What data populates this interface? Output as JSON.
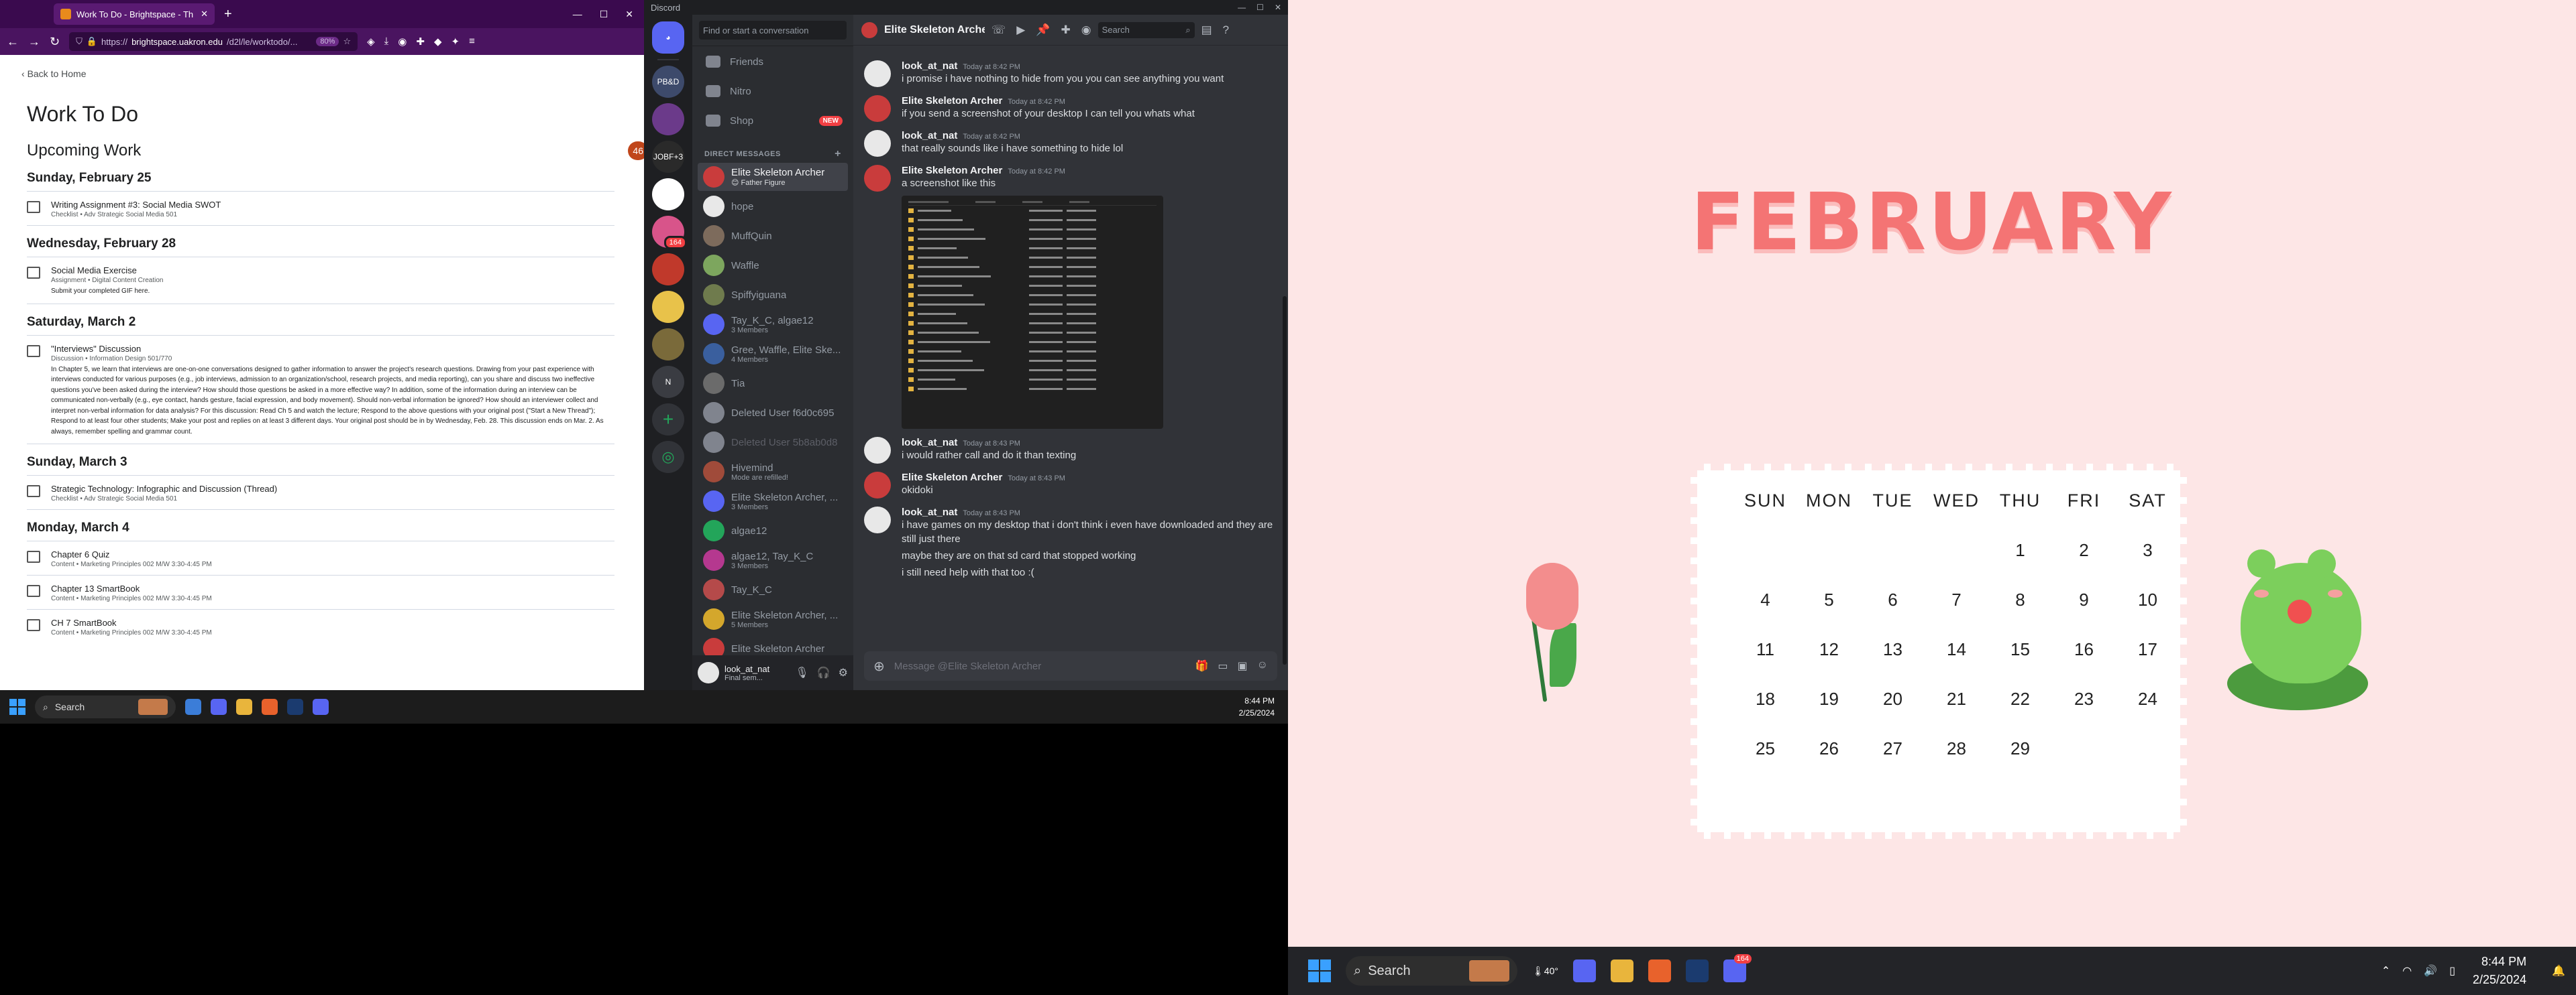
{
  "browser": {
    "tab_title": "Work To Do - Brightspace - Th",
    "url_prefix": "https://",
    "url_domain": "brightspace.uakron.edu",
    "url_path": "/d2l/le/worktodo/...",
    "zoom": "80%"
  },
  "brightspace": {
    "back_label": "Back to Home",
    "title": "Work To Do",
    "upcoming_label": "Upcoming Work",
    "upcoming_count": "46",
    "days": [
      {
        "label": "Sunday, February 25",
        "items": [
          {
            "name": "Writing Assignment #3: Social Media SWOT",
            "meta": "Checklist • Adv Strategic Social Media 501",
            "desc": ""
          }
        ]
      },
      {
        "label": "Wednesday, February 28",
        "items": [
          {
            "name": "Social Media Exercise",
            "meta": "Assignment • Digital Content Creation",
            "desc": "Submit your completed GIF here."
          }
        ]
      },
      {
        "label": "Saturday, March 2",
        "items": [
          {
            "name": "\"Interviews\" Discussion",
            "meta": "Discussion • Information Design 501/770",
            "desc": "In Chapter 5, we learn that interviews are one-on-one conversations designed to gather information to answer the project's research questions. Drawing from your past experience with interviews conducted for various purposes (e.g., job interviews, admission to an organization/school, research projects, and media reporting), can you share and discuss two ineffective questions you've been asked during the interview? How should those questions be asked in a more effective way? In addition, some of the information during an interview can be communicated non-verbally (e.g., eye contact, hands gesture, facial expression, and body movement). Should non-verbal information be ignored? How should an interviewer collect and interpret non-verbal information for data analysis? For this discussion: Read Ch 5 and watch the lecture; Respond to the above questions with your original post (\"Start a New Thread\"); Respond to at least four other students; Make your post and replies on at least 3 different days. Your original post should be in by Wednesday, Feb. 28. This discussion ends on Mar. 2. As always, remember spelling and grammar count."
          }
        ]
      },
      {
        "label": "Sunday, March 3",
        "items": [
          {
            "name": "Strategic Technology: Infographic and Discussion (Thread)",
            "meta": "Checklist • Adv Strategic Social Media 501",
            "desc": ""
          }
        ]
      },
      {
        "label": "Monday, March 4",
        "items": [
          {
            "name": "Chapter 6 Quiz",
            "meta": "Content • Marketing Principles 002 M/W 3:30-4:45 PM",
            "desc": ""
          },
          {
            "name": "Chapter 13 SmartBook",
            "meta": "Content • Marketing Principles 002 M/W 3:30-4:45 PM",
            "desc": ""
          },
          {
            "name": "CH 7 SmartBook",
            "meta": "Content • Marketing Principles 002 M/W 3:30-4:45 PM",
            "desc": ""
          }
        ]
      }
    ]
  },
  "taskbar_left": {
    "search_label": "Search",
    "time": "8:44 PM",
    "date": "2/25/2024"
  },
  "discord": {
    "app_title": "Discord",
    "find_placeholder": "Find or start a conversation",
    "guilds": [
      {
        "label": "PB&D",
        "badge": ""
      },
      {
        "label": "",
        "badge": ""
      },
      {
        "label": "JOBF+3",
        "badge": ""
      },
      {
        "label": "",
        "badge": ""
      },
      {
        "label": "",
        "badge": "164"
      },
      {
        "label": "",
        "badge": ""
      },
      {
        "label": "",
        "badge": ""
      },
      {
        "label": "",
        "badge": ""
      },
      {
        "label": "N",
        "badge": ""
      }
    ],
    "nav": [
      {
        "label": "Friends",
        "badge": ""
      },
      {
        "label": "Nitro",
        "badge": ""
      },
      {
        "label": "Shop",
        "badge": "NEW"
      }
    ],
    "dm_header": "DIRECT MESSAGES",
    "dms": [
      {
        "name": "Elite Skeleton Archer",
        "status": "😊 Father Figure",
        "color": "#c93c3c",
        "active": true
      },
      {
        "name": "hope",
        "status": "",
        "color": "#e8e8e8"
      },
      {
        "name": "MuffQuin",
        "status": "",
        "color": "#7d6b5c"
      },
      {
        "name": "Waffle",
        "status": "",
        "color": "#7da65e"
      },
      {
        "name": "Spiffyiguana",
        "status": "",
        "color": "#6f7b4d"
      },
      {
        "name": "Tay_K_C, algae12",
        "status": "3 Members",
        "color": "#5865f2"
      },
      {
        "name": "Gree, Waffle, Elite Ske...",
        "status": "4 Members",
        "color": "#3a5f9e"
      },
      {
        "name": "Tia",
        "status": "",
        "color": "#6b6b6b"
      },
      {
        "name": "Deleted User f6d0c695",
        "status": "",
        "color": "#80848e"
      },
      {
        "name": "Deleted User 5b8ab0d8",
        "status": "",
        "color": "#80848e",
        "faded": true
      },
      {
        "name": "Hivemind",
        "status": "Mode are refilled!",
        "color": "#a04b3a"
      },
      {
        "name": "Elite Skeleton Archer, ...",
        "status": "3 Members",
        "color": "#5865f2"
      },
      {
        "name": "algae12",
        "status": "",
        "color": "#23a55a"
      },
      {
        "name": "algae12, Tay_K_C",
        "status": "3 Members",
        "color": "#b5388f"
      },
      {
        "name": "Tay_K_C",
        "status": "",
        "color": "#b54a4a"
      },
      {
        "name": "Elite Skeleton Archer, ...",
        "status": "5 Members",
        "color": "#d4a72c"
      },
      {
        "name": "Elite Skeleton Archer",
        "status": "",
        "color": "#c93c3c"
      }
    ],
    "user": {
      "name": "look_at_nat",
      "status": "Final sem..."
    },
    "header_name": "Elite Skeleton Archer",
    "search_placeholder": "Search",
    "messages": [
      {
        "author": "look_at_nat",
        "time": "Today at 8:42 PM",
        "lines": [
          "i promise i have nothing to hide from you you can see anything you want"
        ],
        "av": "#e8e8e8"
      },
      {
        "author": "Elite Skeleton Archer",
        "time": "Today at 8:42 PM",
        "lines": [
          "if you send a screenshot of your desktop I can tell you whats what"
        ],
        "av": "#c93c3c"
      },
      {
        "author": "look_at_nat",
        "time": "Today at 8:42 PM",
        "lines": [
          "that really sounds like i have something to hide lol"
        ],
        "av": "#e8e8e8"
      },
      {
        "author": "Elite Skeleton Archer",
        "time": "Today at 8:42 PM",
        "lines": [
          "a screenshot like this"
        ],
        "av": "#c93c3c",
        "image": true
      },
      {
        "author": "look_at_nat",
        "time": "Today at 8:43 PM",
        "lines": [
          "i would rather call and do it than texting"
        ],
        "av": "#e8e8e8"
      },
      {
        "author": "Elite Skeleton Archer",
        "time": "Today at 8:43 PM",
        "lines": [
          "okidoki"
        ],
        "av": "#c93c3c"
      },
      {
        "author": "look_at_nat",
        "time": "Today at 8:43 PM",
        "lines": [
          "i have games on my desktop that i don't think i even have downloaded and they are still just there",
          "maybe they are on that sd card that stopped working",
          "i still need help with that too :("
        ],
        "av": "#e8e8e8"
      }
    ],
    "composer_placeholder": "Message @Elite Skeleton Archer"
  },
  "calendar": {
    "month": "FEBRUARY",
    "weekdays": [
      "SUN",
      "MON",
      "TUE",
      "WED",
      "THU",
      "FRI",
      "SAT"
    ],
    "days": [
      "",
      "",
      "",
      "",
      "1",
      "2",
      "3",
      "4",
      "5",
      "6",
      "7",
      "8",
      "9",
      "10",
      "11",
      "12",
      "13",
      "14",
      "15",
      "16",
      "17",
      "18",
      "19",
      "20",
      "21",
      "22",
      "23",
      "24",
      "25",
      "26",
      "27",
      "28",
      "29",
      "",
      "",
      ""
    ]
  },
  "taskbar_right": {
    "search_label": "Search",
    "weather": "40°",
    "discord_badge": "164",
    "time": "8:44 PM",
    "date": "2/25/2024"
  }
}
